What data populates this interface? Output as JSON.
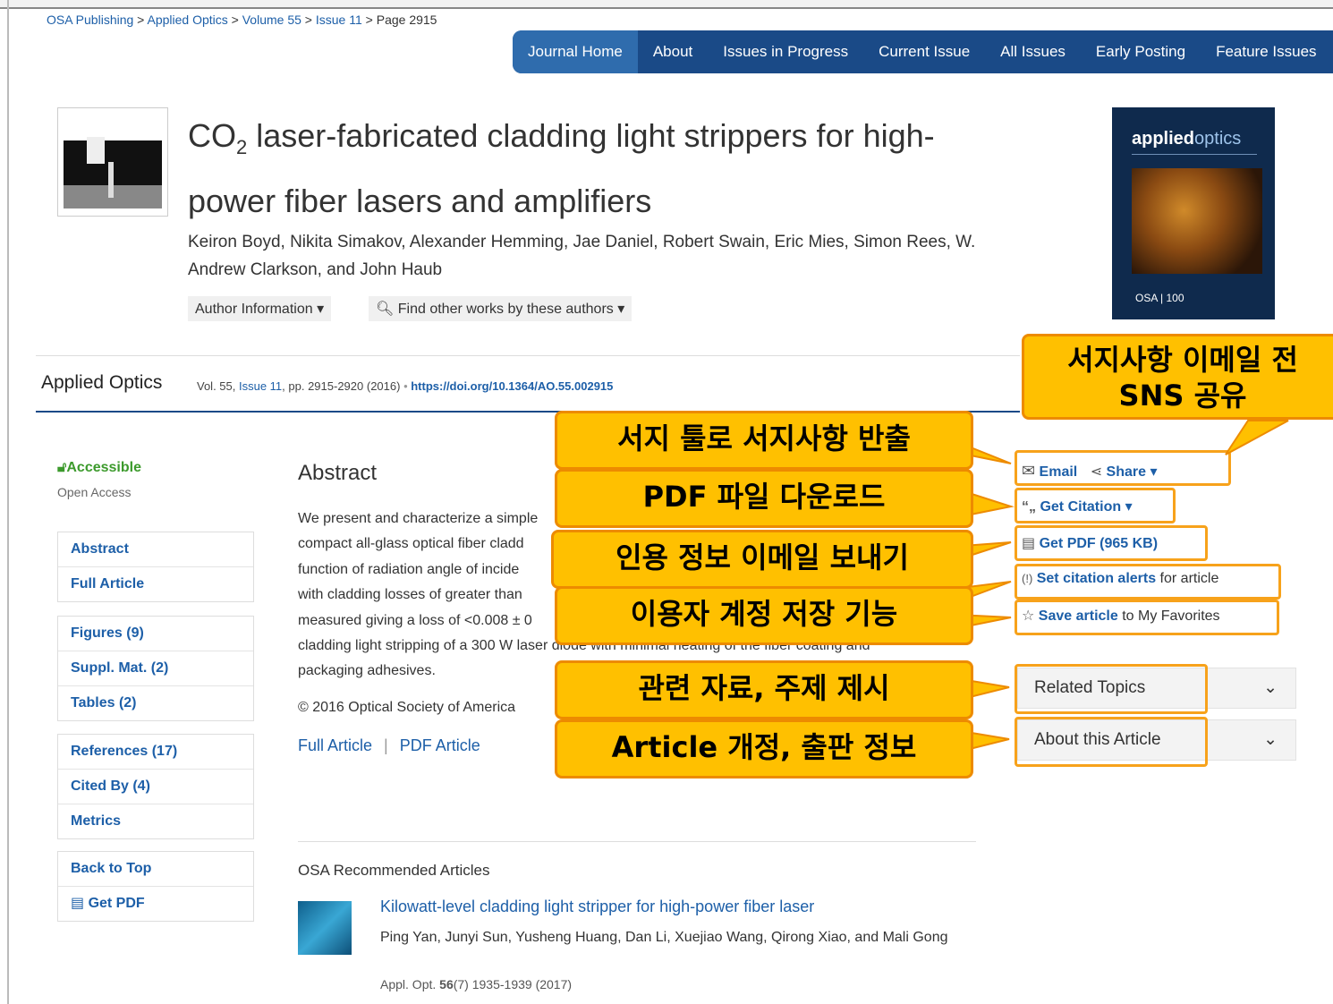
{
  "breadcrumb": {
    "item1": "OSA Publishing",
    "sep": " > ",
    "item2": "Applied Optics",
    "item3": "Volume 55",
    "item4": "Issue 11",
    "item5": "Page 2915"
  },
  "nav": {
    "items": [
      "Journal Home",
      "About",
      "Issues in Progress",
      "Current Issue",
      "All Issues",
      "Early Posting",
      "Feature Issues"
    ]
  },
  "article": {
    "title_co": "CO",
    "title_sub": "2",
    "title_rest": " laser-fabricated cladding light strippers for high-power fiber lasers and amplifiers",
    "authors": "Keiron Boyd, Nikita Simakov, Alexander Hemming, Jae Daniel, Robert Swain, Eric Mies, Simon Rees, W. Andrew Clarkson, and John Haub",
    "author_info_btn": "Author Information",
    "find_works_btn": "Find other works by these authors"
  },
  "cover": {
    "brand_bold": "applied",
    "brand_light": "optics",
    "footer": "OSA | 100"
  },
  "journal_bar": {
    "name": "Applied Optics",
    "vol": "Vol. 55, ",
    "issue_link": "Issue 11",
    "pages": ", pp. 2915-2920  (2016)",
    "dot": " • ",
    "doi": "https://doi.org/10.1364/AO.55.002915"
  },
  "access": {
    "label": "Accessible",
    "type": "Open Access"
  },
  "sidebar": {
    "group1": [
      "Abstract",
      "Full Article"
    ],
    "group2": [
      "Figures (9)",
      "Suppl. Mat. (2)",
      "Tables (2)"
    ],
    "group3": [
      "References (17)",
      "Cited By (4)",
      "Metrics"
    ],
    "group4": [
      "Back to Top",
      "Get PDF"
    ]
  },
  "abstract": {
    "heading": "Abstract",
    "lines": [
      "We present and characterize a simple",
      "compact all-glass optical fiber cladd",
      "function of radiation angle of incide",
      "with cladding losses of greater than",
      "measured giving a loss of <0.008 ± 0",
      "cladding light stripping of a 300 W laser diode with minimal heating of the fiber coating and",
      "packaging adhesives."
    ],
    "copyright": "© 2016 Optical Society of America",
    "full_article_link": "Full Article",
    "pipe": "|",
    "pdf_article_link": "PDF Article"
  },
  "tools": {
    "email": "Email",
    "share": "Share",
    "get_citation": "Get Citation",
    "get_pdf": "Get PDF (965 KB)",
    "alerts_link": "Set citation alerts",
    "alerts_suffix": " for article",
    "save_link": "Save article",
    "save_suffix": " to My Favorites"
  },
  "panels": {
    "related": "Related Topics",
    "about": "About this Article"
  },
  "recommended": {
    "heading": "OSA Recommended Articles",
    "title": "Kilowatt-level cladding light stripper for high-power fiber laser",
    "authors": "Ping Yan, Junyi Sun, Yusheng Huang, Dan Li, Xuejiao Wang, Qirong Xiao, and Mali Gong",
    "cite_pre": "Appl. Opt. ",
    "cite_vol": "56",
    "cite_post": "(7) 1935-1939 (2017)"
  },
  "callouts": {
    "sns_line1": "서지사항 이메일 전",
    "sns_line2": "SNS 공유",
    "citation_export": "서지 툴로 서지사항 반출",
    "pdf_download": "PDF 파일 다운로드",
    "citation_email": "인용 정보 이메일 보내기",
    "save_account": "이용자 계정 저장 기능",
    "related": "관련 자료, 주제 제시",
    "article_info": "Article 개정, 출판 정보"
  },
  "colors": {
    "navy": "#1a4a87",
    "link": "#1d5fa8",
    "callout_fill": "#ffc000",
    "callout_border": "#ed8b00",
    "highlight_box": "#f7a21b",
    "access_green": "#3c9a2c"
  }
}
